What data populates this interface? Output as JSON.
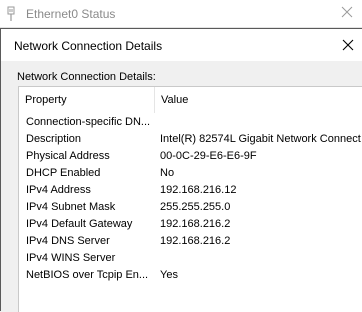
{
  "background_window": {
    "title": "Ethernet0 Status"
  },
  "dialog": {
    "title": "Network Connection Details",
    "section_label": "Network Connection Details:",
    "columns": {
      "property": "Property",
      "value": "Value"
    },
    "rows": [
      {
        "property": "Connection-specific DN...",
        "value": ""
      },
      {
        "property": "Description",
        "value": "Intel(R) 82574L Gigabit Network Connect"
      },
      {
        "property": "Physical Address",
        "value": "00-0C-29-E6-E6-9F"
      },
      {
        "property": "DHCP Enabled",
        "value": "No"
      },
      {
        "property": "IPv4 Address",
        "value": "192.168.216.12"
      },
      {
        "property": "IPv4 Subnet Mask",
        "value": "255.255.255.0"
      },
      {
        "property": "IPv4 Default Gateway",
        "value": "192.168.216.2"
      },
      {
        "property": "IPv4 DNS Server",
        "value": "192.168.216.2"
      },
      {
        "property": "IPv4 WINS Server",
        "value": ""
      },
      {
        "property": "NetBIOS over Tcpip En...",
        "value": "Yes"
      }
    ]
  },
  "icons": {
    "background_window": "network-adapter-icon",
    "close": "close-icon"
  }
}
